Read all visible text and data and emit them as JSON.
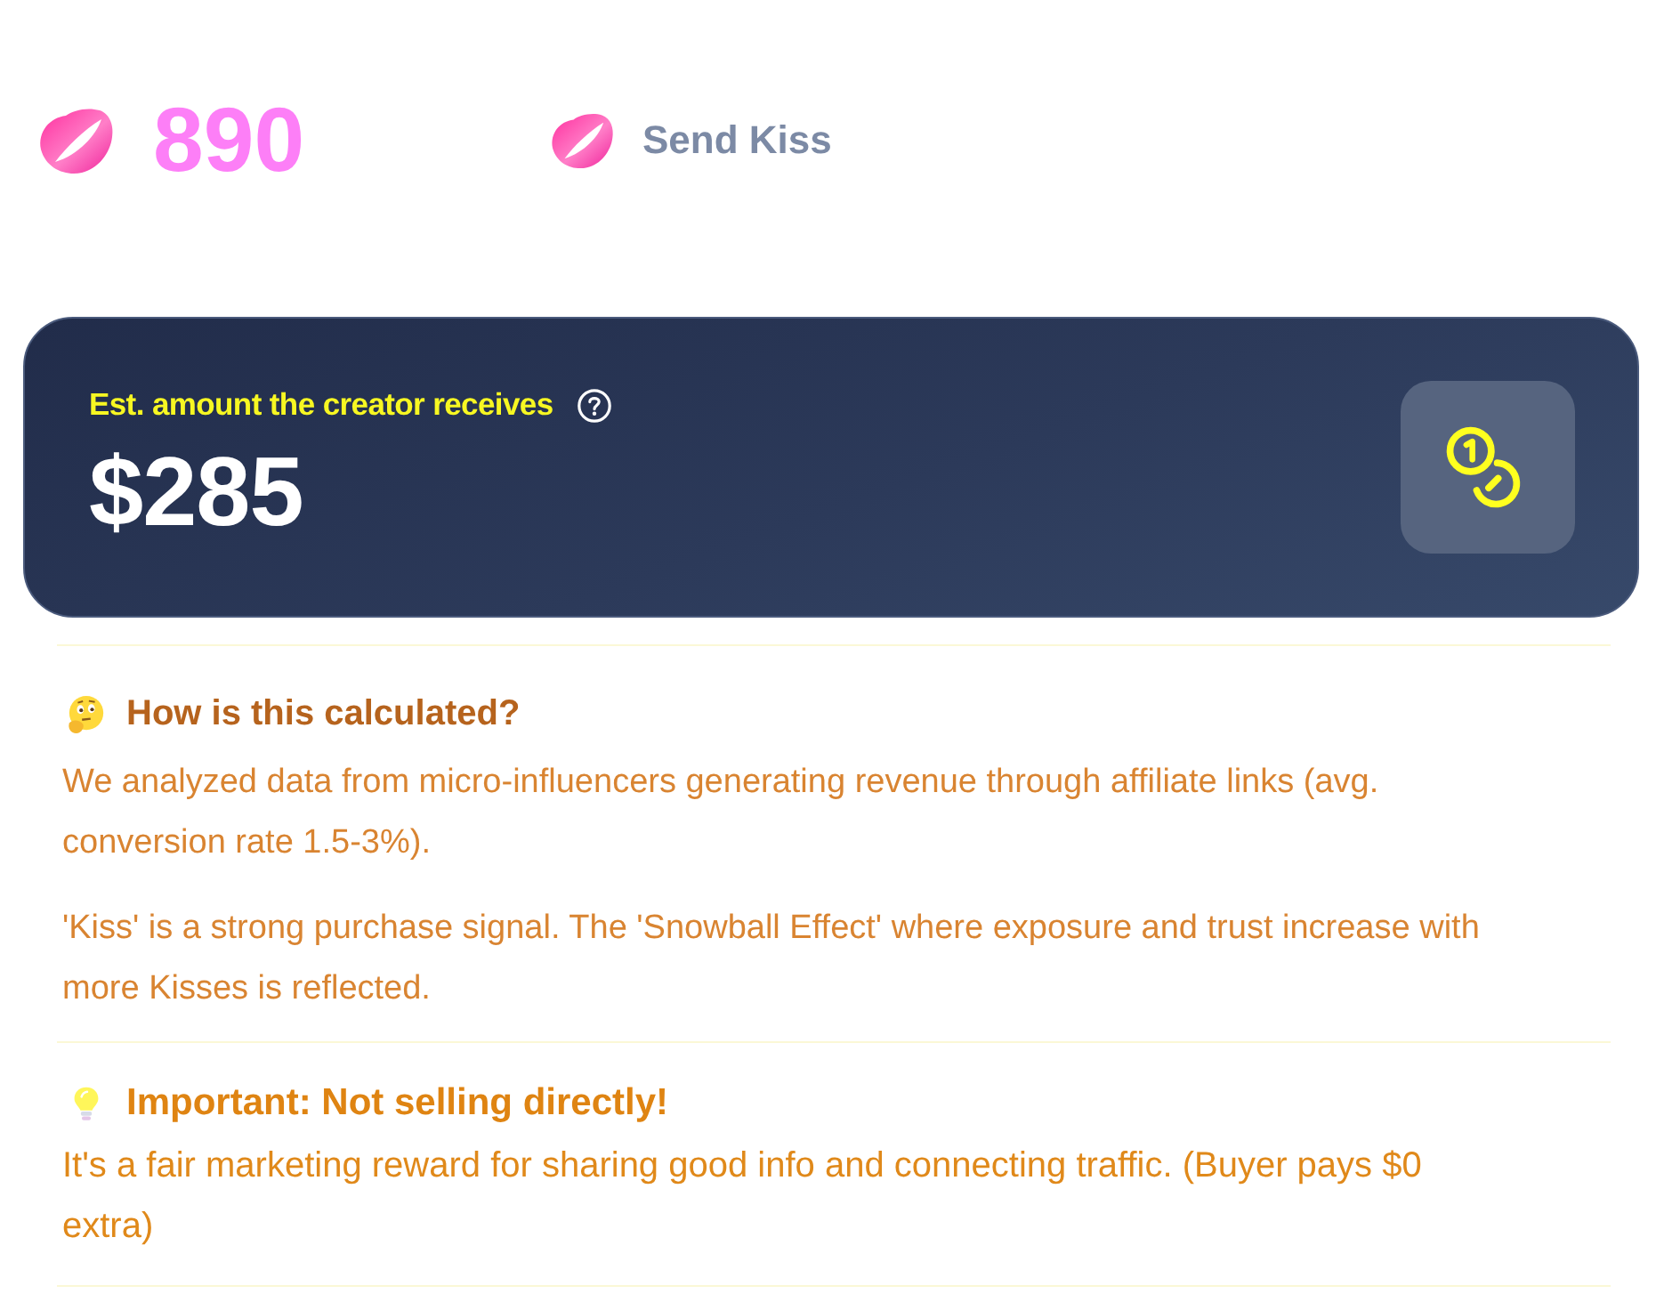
{
  "stats": {
    "kiss_count": "890",
    "send_button": "Send Kiss"
  },
  "earnings_card": {
    "label": "Est. amount the creator receives",
    "amount": "$285"
  },
  "info_sections": [
    {
      "kind": "calculation",
      "title": "How is this calculated?",
      "paragraphs": [
        "We analyzed data from micro-influencers generating revenue through affiliate links (avg. conversion rate 1.5-3%).",
        "'Kiss' is a strong purchase signal. The 'Snowball Effect' where exposure and trust increase with more Kisses is reflected."
      ]
    },
    {
      "kind": "notice",
      "title": "Important: Not selling directly!",
      "paragraphs": [
        "It's a fair marketing reward for sharing good info and connecting traffic. (Buyer pays $0 extra)"
      ]
    }
  ]
}
